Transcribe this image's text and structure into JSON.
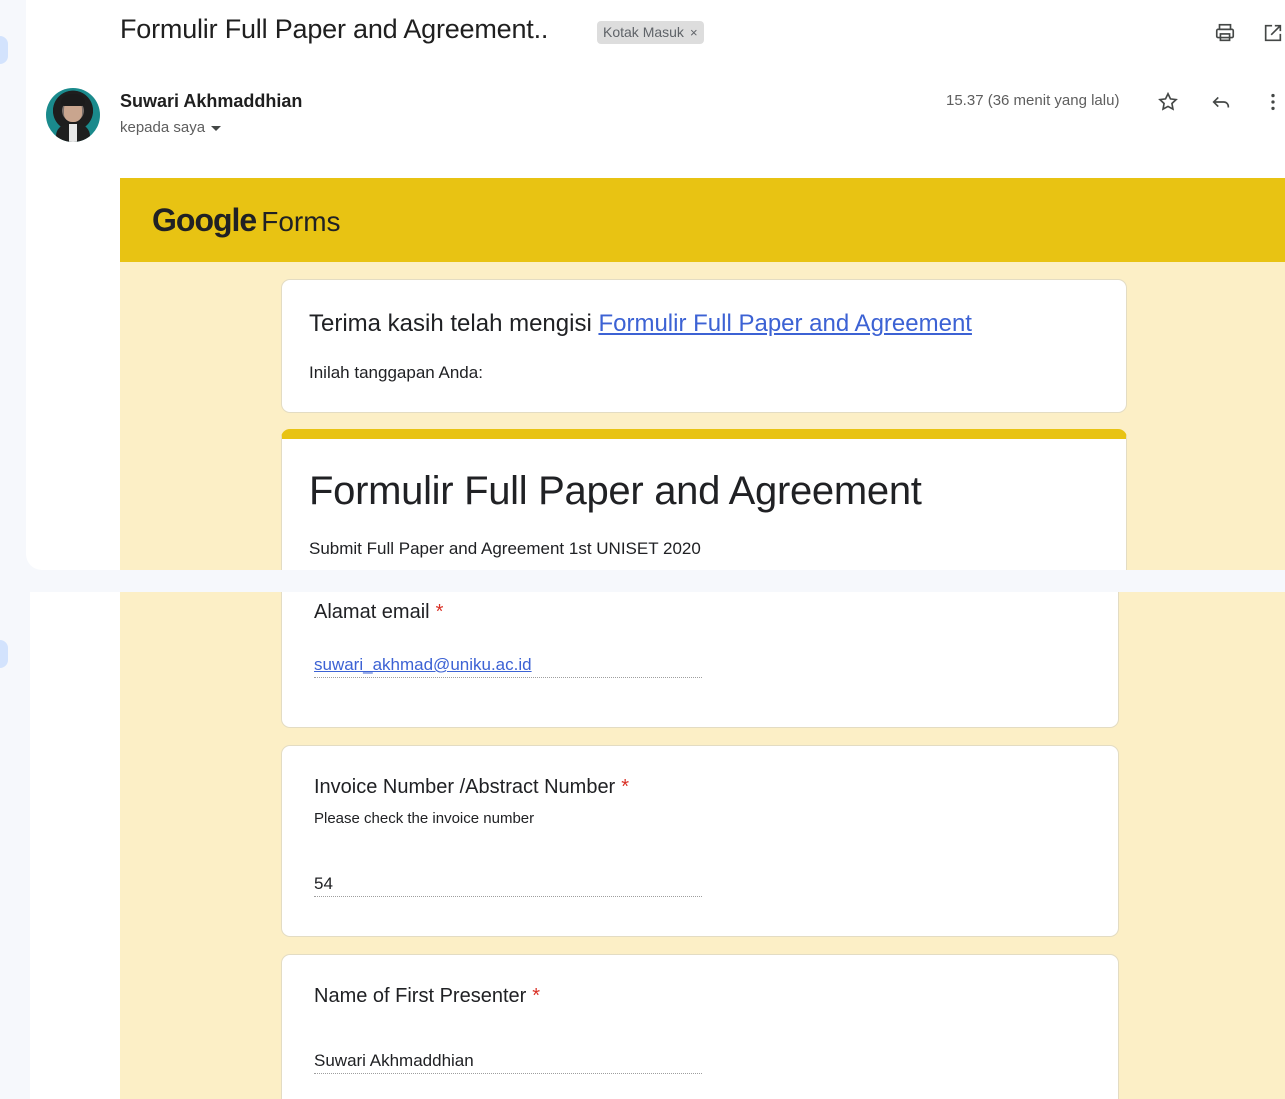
{
  "email": {
    "subject": "Formulir Full Paper and Agreement..",
    "label_chip": "Kotak Masuk",
    "label_close": "×",
    "sender": "Suwari Akhmaddhian",
    "recipient": "kepada saya",
    "time": "15.37 (36 menit yang lalu)"
  },
  "icons": {
    "print": "print-icon",
    "popout": "open-in-new-window-icon",
    "star": "star-icon",
    "reply": "reply-icon",
    "more": "more-vertical-icon",
    "caret": "chevron-down-icon"
  },
  "forms": {
    "brand_google": "Google",
    "brand_forms": "Forms",
    "thanks_prefix": "Terima kasih telah mengisi ",
    "thanks_link": "Formulir Full Paper and Agreement",
    "responses_intro": "Inilah tanggapan Anda:",
    "form_title": "Formulir Full Paper and Agreement",
    "form_description": "Submit Full Paper and Agreement 1st UNISET 2020",
    "questions": [
      {
        "label": "Alamat email",
        "required_mark": "*",
        "hint": "",
        "answer": "suwari_akhmad@uniku.ac.id"
      },
      {
        "label": "Invoice Number /Abstract Number",
        "required_mark": "*",
        "hint": "Please check the invoice number",
        "answer": "54"
      },
      {
        "label": "Name of First Presenter",
        "required_mark": "*",
        "hint": "",
        "answer": "Suwari Akhmaddhian"
      }
    ]
  },
  "colors": {
    "banner": "#e8c313",
    "form_background": "#fcefc6",
    "link": "#3c62d4",
    "required": "#d93025"
  }
}
